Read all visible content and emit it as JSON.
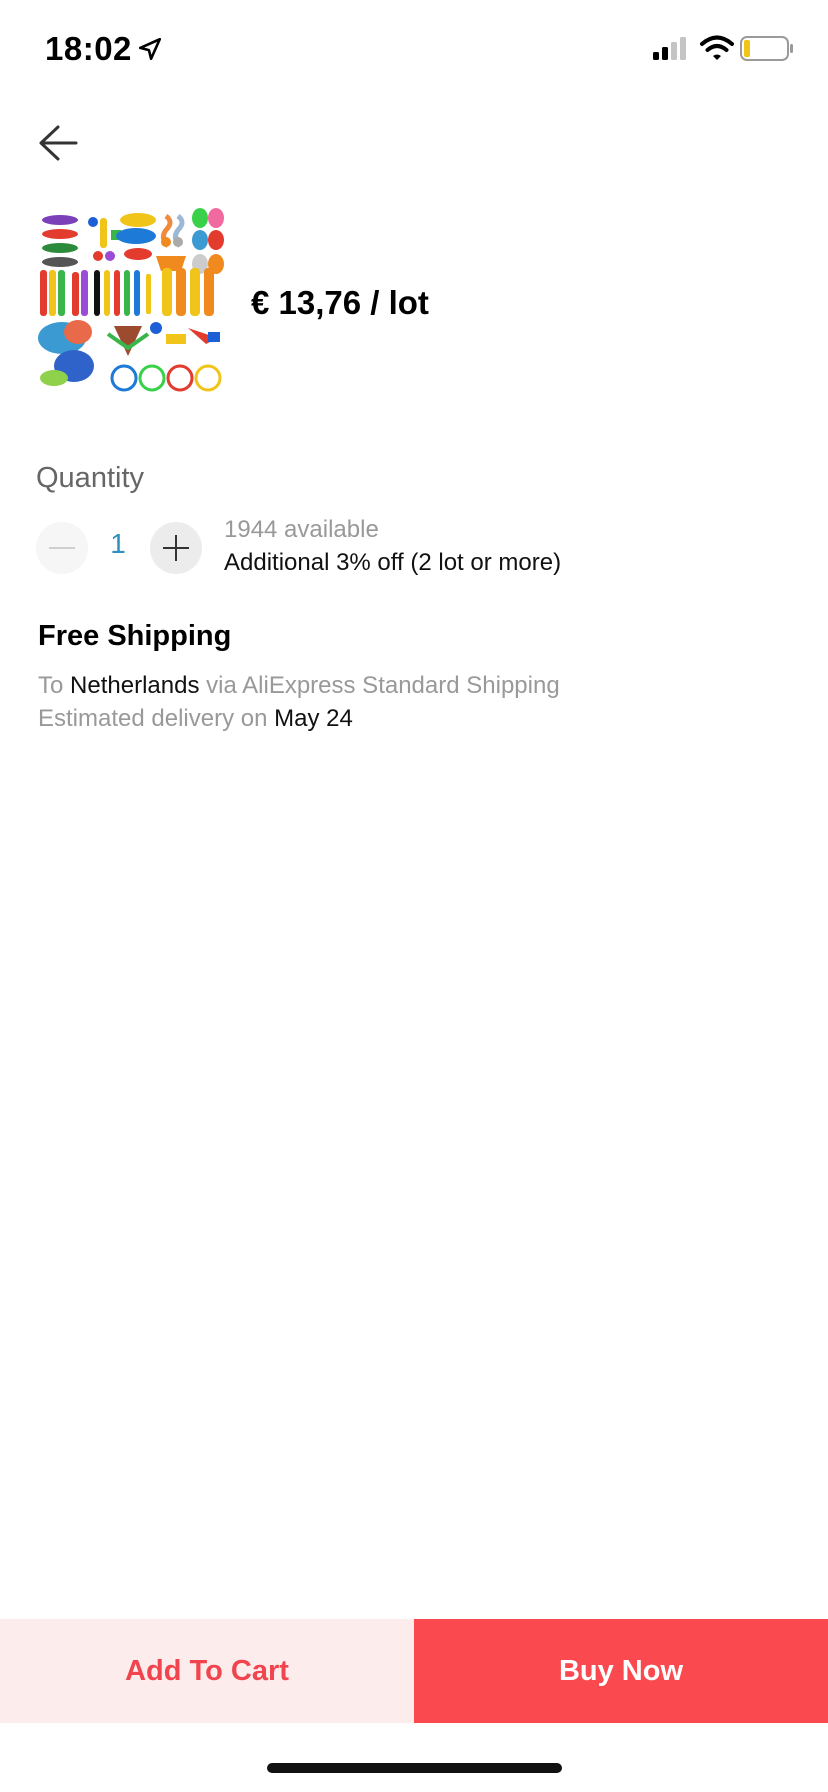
{
  "status_bar": {
    "time": "18:02"
  },
  "product": {
    "price": "€ 13,76 / lot",
    "image_icon": "pool-dive-toys-product-image"
  },
  "quantity": {
    "title": "Quantity",
    "value": "1",
    "available": "1944 available",
    "discount": "Additional 3% off (2 lot or more)"
  },
  "shipping": {
    "title": "Free Shipping",
    "to_prefix": "To",
    "destination": "Netherlands",
    "via": "via AliExpress Standard Shipping",
    "delivery_prefix": "Estimated delivery on",
    "delivery_date": "May 24"
  },
  "actions": {
    "add_to_cart": "Add To Cart",
    "buy_now": "Buy Now"
  },
  "colors": {
    "accent_red": "#fa4a4f",
    "light_red": "#fdecec",
    "quantity_blue": "#2f8fbf"
  }
}
